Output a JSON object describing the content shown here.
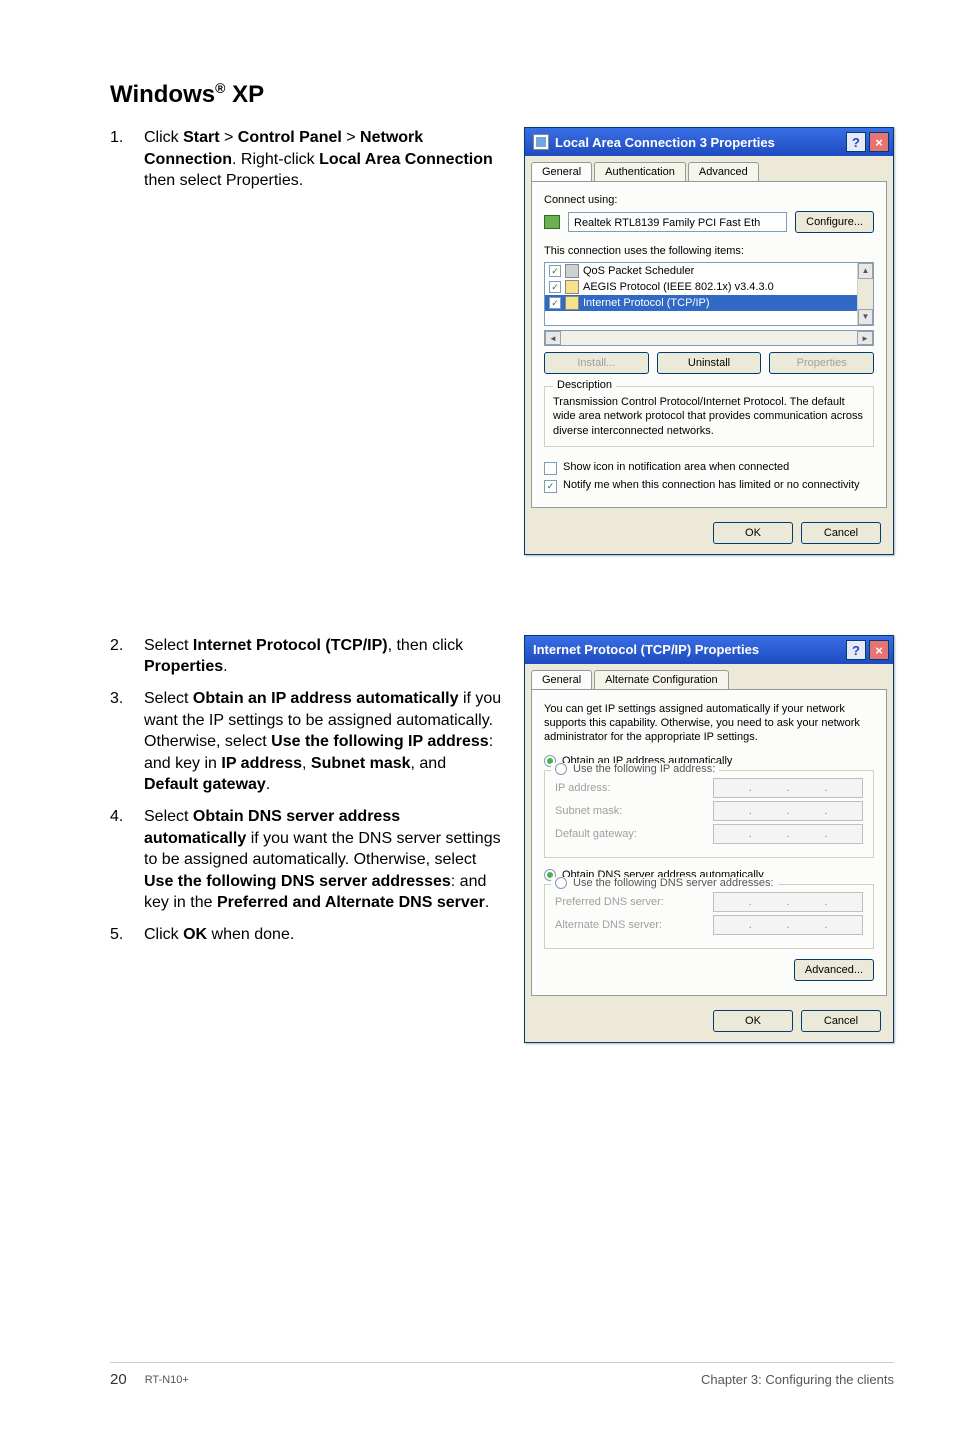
{
  "heading_prefix": "Windows",
  "heading_reg": "®",
  "heading_suffix": " XP",
  "step1_num": "1.",
  "step1_a": "Click ",
  "step1_start": "Start",
  "step1_gt1": " > ",
  "step1_cp": "Control Panel",
  "step1_gt2": " > ",
  "step1_nc": "Network Connection",
  "step1_b": ". Right-click ",
  "step1_lac": "Local Area Connection",
  "step1_c": " then select Properties.",
  "d1": {
    "title": "Local Area Connection 3 Properties",
    "tab_general": "General",
    "tab_auth": "Authentication",
    "tab_adv": "Advanced",
    "connect_using": "Connect using:",
    "adapter": "Realtek RTL8139 Family PCI Fast Eth",
    "configure": "Configure...",
    "uses_items": "This connection uses the following items:",
    "item1": "QoS Packet Scheduler",
    "item2": "AEGIS Protocol (IEEE 802.1x) v3.4.3.0",
    "item3": "Internet Protocol (TCP/IP)",
    "install": "Install...",
    "uninstall": "Uninstall",
    "properties": "Properties",
    "desc_legend": "Description",
    "desc_text": "Transmission Control Protocol/Internet Protocol. The default wide area network protocol that provides communication across diverse interconnected networks.",
    "show_icon": "Show icon in notification area when connected",
    "notify": "Notify me when this connection has limited or no connectivity",
    "ok": "OK",
    "cancel": "Cancel"
  },
  "step2_num": "2.",
  "step2_a": "Select ",
  "step2_ip": "Internet Protocol (TCP/IP)",
  "step2_b": ", then click ",
  "step2_props": "Properties",
  "step2_c": ".",
  "step3_num": "3.",
  "step3_a": "Select ",
  "step3_obtain": "Obtain an IP address automatically",
  "step3_b": " if you want the IP settings to be assigned automatically. Otherwise, select ",
  "step3_usefoll": "Use the following IP address",
  "step3_c": ": and key in ",
  "step3_ipaddr": "IP address",
  "step3_d": ", ",
  "step3_subnet": "Subnet mask",
  "step3_e": ", and ",
  "step3_gateway": "Default gateway",
  "step3_f": ".",
  "step4_num": "4.",
  "step4_a": "Select ",
  "step4_dns": "Obtain DNS server address automatically",
  "step4_b": " if you want the DNS server settings to be assigned automatically. Otherwise, select ",
  "step4_usedns": "Use the following DNS server addresses",
  "step4_c": ": and key in the ",
  "step4_prefalt": "Preferred and Alternate DNS server",
  "step4_d": ".",
  "step5_num": "5.",
  "step5_a": "Click ",
  "step5_ok": "OK",
  "step5_b": " when done.",
  "d2": {
    "title": "Internet Protocol (TCP/IP) Properties",
    "tab_general": "General",
    "tab_alt": "Alternate Configuration",
    "intro": "You can get IP settings assigned automatically if your network supports this capability. Otherwise, you need to ask your network administrator for the appropriate IP settings.",
    "obtain_ip": "Obtain an IP address automatically",
    "use_ip": "Use the following IP address:",
    "ipaddr": "IP address:",
    "subnet": "Subnet mask:",
    "gateway": "Default gateway:",
    "obtain_dns": "Obtain DNS server address automatically",
    "use_dns": "Use the following DNS server addresses:",
    "pref_dns": "Preferred DNS server:",
    "alt_dns": "Alternate DNS server:",
    "advanced": "Advanced...",
    "ok": "OK",
    "cancel": "Cancel"
  },
  "footer": {
    "page": "20",
    "model": "RT-N10+",
    "chapter": "Chapter 3: Configuring the clients"
  }
}
